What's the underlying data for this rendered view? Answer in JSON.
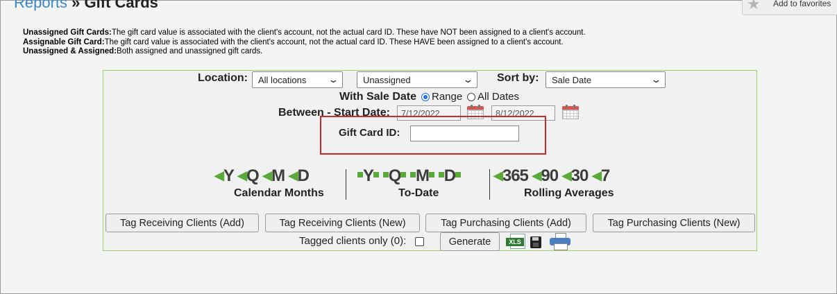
{
  "header": {
    "breadcrumb_parent": "Reports",
    "breadcrumb_sep": "»",
    "breadcrumb_current": "Gift Cards",
    "favorites_label": "Add to favorites"
  },
  "definitions": [
    {
      "term": "Unassigned Gift Cards:",
      "text": "The gift card value is associated with the client's account, not the actual card ID. These have NOT been assigned to a client's account."
    },
    {
      "term": "Assignable Gift Card:",
      "text": "The gift card value is associated with the client's account, not the actual card ID. These HAVE been assigned to a client's account."
    },
    {
      "term": "Unassigned & Assigned:",
      "text": "Both assigned and unassigned gift cards."
    }
  ],
  "filters": {
    "location_label": "Location:",
    "location_value": "All locations",
    "assignment_value": "Unassigned",
    "sortby_label": "Sort by:",
    "sortby_value": "Sale Date",
    "sale_date_label": "With Sale Date",
    "radio_range": "Range",
    "radio_all": "All Dates",
    "between_label": "Between - Start Date:",
    "start_date": "7/12/2022",
    "end_date": "8/12/2022",
    "giftcard_label": "Gift Card ID:",
    "giftcard_value": ""
  },
  "quick_ranges": {
    "calendar": {
      "items": [
        "Y",
        "Q",
        "M",
        "D"
      ],
      "label": "Calendar Months"
    },
    "todate": {
      "items": [
        "Y",
        "Q",
        "M",
        "D"
      ],
      "label": "To-Date"
    },
    "rolling": {
      "items": [
        "365",
        "90",
        "30",
        "7"
      ],
      "label": "Rolling Averages"
    }
  },
  "actions": {
    "tag_receiving_add": "Tag Receiving Clients (Add)",
    "tag_receiving_new": "Tag Receiving Clients (New)",
    "tag_purchasing_add": "Tag Purchasing Clients (Add)",
    "tag_purchasing_new": "Tag Purchasing Clients (New)",
    "tagged_only_label": "Tagged clients only (0):",
    "generate": "Generate",
    "xls_label": "XLS"
  },
  "colors": {
    "accent_green": "#5aa93a",
    "highlight_red": "#cc2b2b",
    "link_blue": "#3a86c8",
    "panel_border": "#9ccf70"
  }
}
